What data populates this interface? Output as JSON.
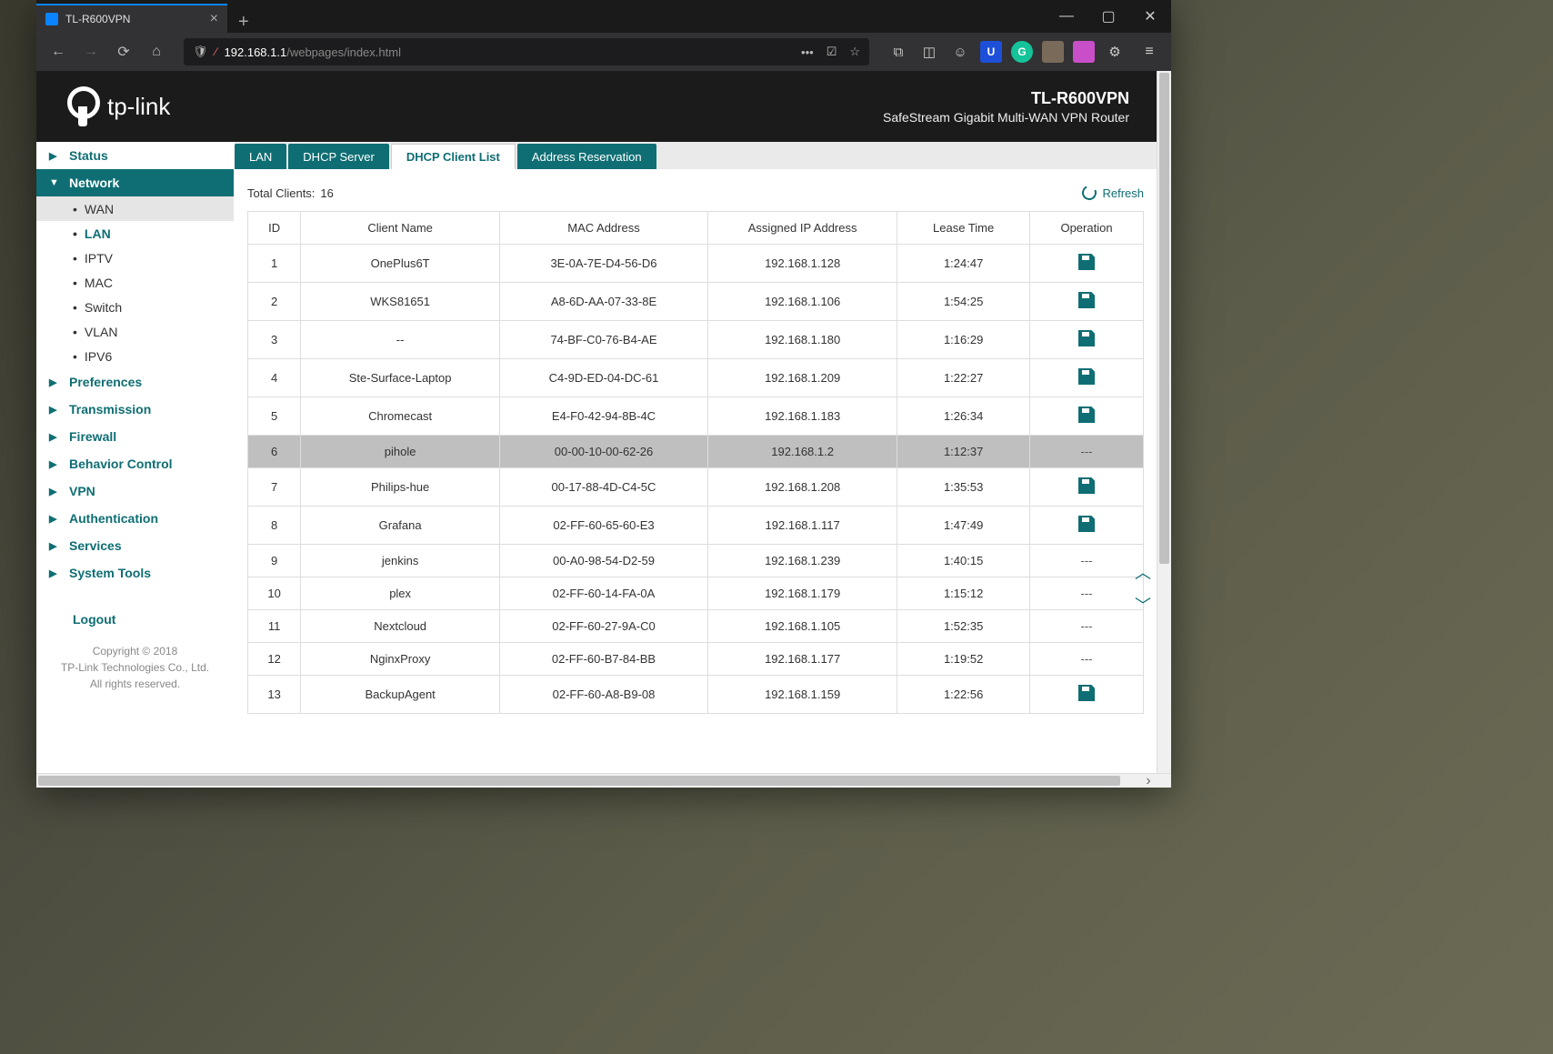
{
  "browser": {
    "tab_title": "TL-R600VPN",
    "url_host": "192.168.1.1",
    "url_path": "/webpages/index.html"
  },
  "header": {
    "brand": "tp-link",
    "model": "TL-R600VPN",
    "description": "SafeStream Gigabit Multi-WAN VPN Router"
  },
  "sidebar": {
    "items": [
      {
        "label": "Status",
        "expanded": false
      },
      {
        "label": "Network",
        "expanded": true,
        "children": [
          {
            "label": "WAN",
            "selected": false,
            "active_bg": true
          },
          {
            "label": "LAN",
            "selected": true
          },
          {
            "label": "IPTV"
          },
          {
            "label": "MAC"
          },
          {
            "label": "Switch"
          },
          {
            "label": "VLAN"
          },
          {
            "label": "IPV6"
          }
        ]
      },
      {
        "label": "Preferences"
      },
      {
        "label": "Transmission"
      },
      {
        "label": "Firewall"
      },
      {
        "label": "Behavior Control"
      },
      {
        "label": "VPN"
      },
      {
        "label": "Authentication"
      },
      {
        "label": "Services"
      },
      {
        "label": "System Tools"
      }
    ],
    "logout": "Logout",
    "copyright_line1": "Copyright © 2018",
    "copyright_line2": "TP-Link Technologies Co., Ltd.",
    "copyright_line3": "All rights reserved."
  },
  "tabs": {
    "items": [
      {
        "label": "LAN",
        "active": false
      },
      {
        "label": "DHCP Server",
        "active": false
      },
      {
        "label": "DHCP Client List",
        "active": true
      },
      {
        "label": "Address Reservation",
        "active": false
      }
    ]
  },
  "totals": {
    "label": "Total Clients:",
    "value": "16",
    "refresh": "Refresh"
  },
  "table": {
    "headers": {
      "id": "ID",
      "name": "Client Name",
      "mac": "MAC Address",
      "ip": "Assigned IP Address",
      "lease": "Lease Time",
      "op": "Operation"
    },
    "rows": [
      {
        "id": "1",
        "name": "OnePlus6T",
        "mac": "3E-0A-7E-D4-56-D6",
        "ip": "192.168.1.128",
        "lease": "1:24:47",
        "op": "save"
      },
      {
        "id": "2",
        "name": "WKS81651",
        "mac": "A8-6D-AA-07-33-8E",
        "ip": "192.168.1.106",
        "lease": "1:54:25",
        "op": "save"
      },
      {
        "id": "3",
        "name": "--",
        "mac": "74-BF-C0-76-B4-AE",
        "ip": "192.168.1.180",
        "lease": "1:16:29",
        "op": "save"
      },
      {
        "id": "4",
        "name": "Ste-Surface-Laptop",
        "mac": "C4-9D-ED-04-DC-61",
        "ip": "192.168.1.209",
        "lease": "1:22:27",
        "op": "save"
      },
      {
        "id": "5",
        "name": "Chromecast",
        "mac": "E4-F0-42-94-8B-4C",
        "ip": "192.168.1.183",
        "lease": "1:26:34",
        "op": "save"
      },
      {
        "id": "6",
        "name": "pihole",
        "mac": "00-00-10-00-62-26",
        "ip": "192.168.1.2",
        "lease": "1:12:37",
        "op": "none",
        "highlight": true
      },
      {
        "id": "7",
        "name": "Philips-hue",
        "mac": "00-17-88-4D-C4-5C",
        "ip": "192.168.1.208",
        "lease": "1:35:53",
        "op": "save"
      },
      {
        "id": "8",
        "name": "Grafana",
        "mac": "02-FF-60-65-60-E3",
        "ip": "192.168.1.117",
        "lease": "1:47:49",
        "op": "save"
      },
      {
        "id": "9",
        "name": "jenkins",
        "mac": "00-A0-98-54-D2-59",
        "ip": "192.168.1.239",
        "lease": "1:40:15",
        "op": "none"
      },
      {
        "id": "10",
        "name": "plex",
        "mac": "02-FF-60-14-FA-0A",
        "ip": "192.168.1.179",
        "lease": "1:15:12",
        "op": "none"
      },
      {
        "id": "11",
        "name": "Nextcloud",
        "mac": "02-FF-60-27-9A-C0",
        "ip": "192.168.1.105",
        "lease": "1:52:35",
        "op": "none"
      },
      {
        "id": "12",
        "name": "NginxProxy",
        "mac": "02-FF-60-B7-84-BB",
        "ip": "192.168.1.177",
        "lease": "1:19:52",
        "op": "none"
      },
      {
        "id": "13",
        "name": "BackupAgent",
        "mac": "02-FF-60-A8-B9-08",
        "ip": "192.168.1.159",
        "lease": "1:22:56",
        "op": "save"
      }
    ]
  }
}
